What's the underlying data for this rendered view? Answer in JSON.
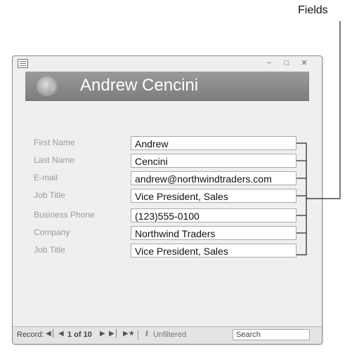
{
  "callout": {
    "label": "Fields"
  },
  "window": {
    "minimize_icon": "minimize-icon",
    "maximize_icon": "maximize-icon",
    "close_icon": "close-icon"
  },
  "header": {
    "title": "Andrew Cencini"
  },
  "form": {
    "fields": [
      {
        "label": "First Name",
        "value": "Andrew"
      },
      {
        "label": "Last Name",
        "value": "Cencini"
      },
      {
        "label": "E-mail",
        "value": "andrew@northwindtraders.com"
      },
      {
        "label": "Job Title",
        "value": "Vice President, Sales"
      },
      {
        "label": "Business Phone",
        "value": "(123)555-0100"
      },
      {
        "label": "Company",
        "value": "Northwind Traders"
      },
      {
        "label": "Job Title",
        "value": "Vice President, Sales"
      }
    ]
  },
  "navigation": {
    "record_label": "Record:",
    "record_position": "1 of 10",
    "filter_label": "Unfiltered",
    "search_placeholder": "Search"
  }
}
